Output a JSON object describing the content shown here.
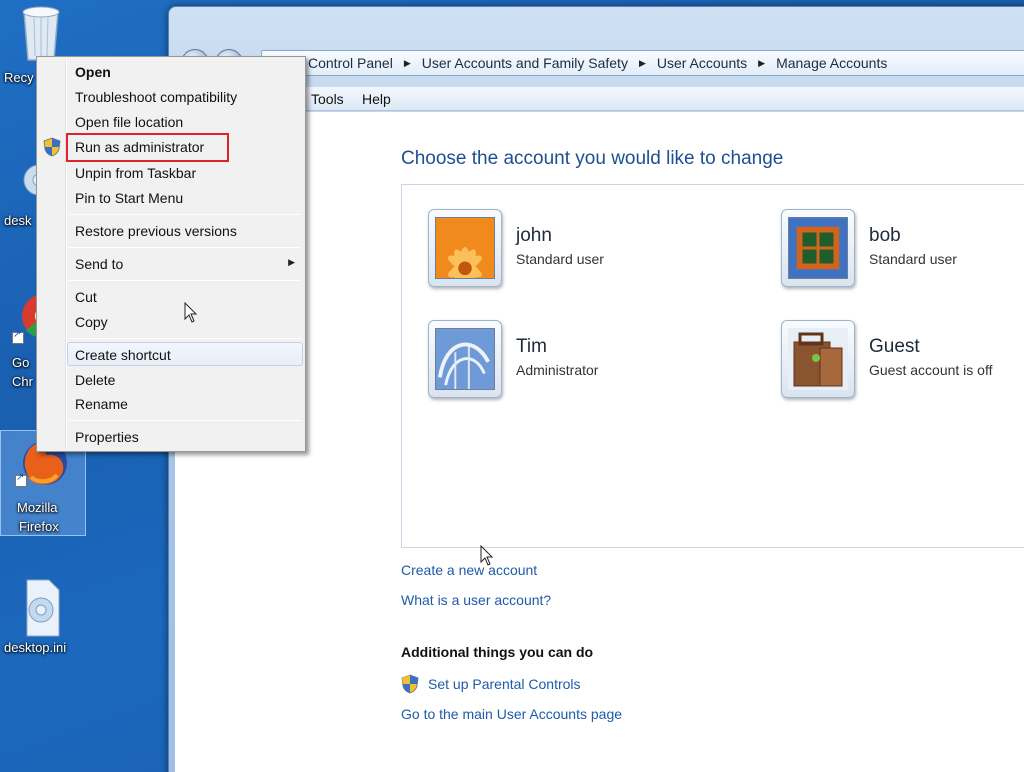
{
  "desktop": {
    "icons": {
      "recycle": "Recy",
      "desktop_top": "desk",
      "chrome_line1": "Go",
      "chrome_line2": "Chr",
      "firefox_line1": "Mozilla",
      "firefox_line2": "Firefox",
      "desktop_ini": "desktop.ini"
    }
  },
  "window": {
    "breadcrumbs": [
      "Control Panel",
      "User Accounts and Family Safety",
      "User Accounts",
      "Manage Accounts"
    ],
    "menu": {
      "tools": "Tools",
      "help": "Help"
    },
    "heading": "Choose the account you would like to change",
    "accounts": [
      {
        "name": "john",
        "type": "Standard user",
        "avatar": "flower-avatar"
      },
      {
        "name": "bob",
        "type": "Standard user",
        "avatar": "window-frame-avatar"
      },
      {
        "name": "Tim",
        "type": "Administrator",
        "avatar": "rollercoaster-avatar"
      },
      {
        "name": "Guest",
        "type": "Guest account is off",
        "avatar": "briefcase-avatar"
      }
    ],
    "links": {
      "create_account": "Create a new account",
      "what_is": "What is a user account?",
      "additional_heading": "Additional things you can do",
      "parental_controls": "Set up Parental Controls",
      "main_page": "Go to the main User Accounts page"
    }
  },
  "context_menu": {
    "items": {
      "open": "Open",
      "troubleshoot": "Troubleshoot compatibility",
      "open_location": "Open file location",
      "run_admin": "Run as administrator",
      "unpin": "Unpin from Taskbar",
      "pin_start": "Pin to Start Menu",
      "restore": "Restore previous versions",
      "send_to": "Send to",
      "cut": "Cut",
      "copy": "Copy",
      "create_shortcut": "Create shortcut",
      "delete": "Delete",
      "rename": "Rename",
      "properties": "Properties"
    },
    "highlight_color": "#e0222a"
  }
}
